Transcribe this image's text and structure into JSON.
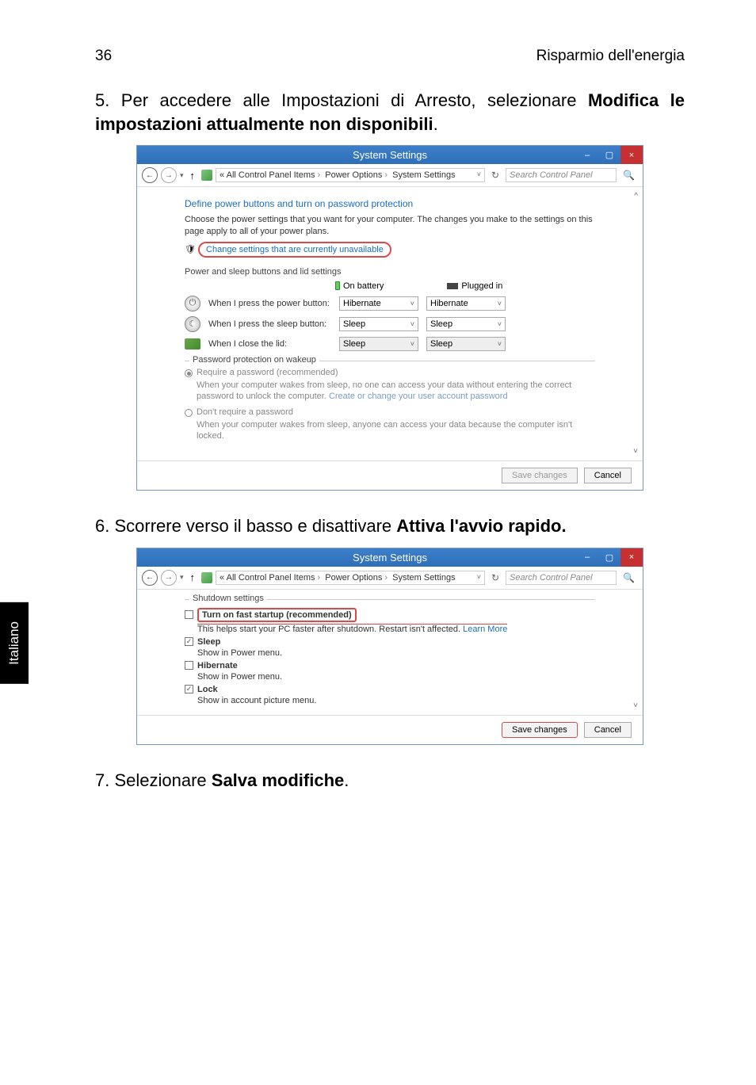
{
  "header": {
    "page_num": "36",
    "doc_title": "Risparmio dell'energia"
  },
  "sidebar_label": "Italiano",
  "step5": {
    "prefix": "5. Per accedere alle Impostazioni di Arresto, selezionare ",
    "bold": "Modifica le impostazioni attualmente non disponibili",
    "suffix": "."
  },
  "step6": {
    "prefix": "6. Scorrere verso il basso e disattivare ",
    "bold": "Attiva l'avvio rapido.",
    "suffix": ""
  },
  "step7": {
    "prefix": "7. Selezionare ",
    "bold": "Salva modifiche",
    "suffix": "."
  },
  "win": {
    "title": "System Settings",
    "min": "–",
    "max": "▢",
    "close": "×",
    "back": "←",
    "fwd": "→",
    "up": "↑",
    "refresh": "↻",
    "search_placeholder": "Search Control Panel",
    "mag": "🔍",
    "breadcrumb": {
      "pre": "«",
      "p1": "All Control Panel Items",
      "p2": "Power Options",
      "p3": "System Settings",
      "sep": "›"
    }
  },
  "shot1": {
    "heading": "Define power buttons and turn on password protection",
    "intro": "Choose the power settings that you want for your computer. The changes you make to the settings on this page apply to all of your power plans.",
    "change_link": "Change settings that are currently unavailable",
    "shield": "🛡",
    "section1": "Power and sleep buttons and lid settings",
    "col_battery": "On battery",
    "col_plugged": "Plugged in",
    "rows": {
      "power": {
        "label": "When I press the power button:",
        "op_b": "Hibernate",
        "op_p": "Hibernate"
      },
      "sleep": {
        "label": "When I press the sleep button:",
        "op_b": "Sleep",
        "op_p": "Sleep"
      },
      "lid": {
        "label": "When I close the lid:",
        "op_b": "Sleep",
        "op_p": "Sleep"
      }
    },
    "protection": {
      "legend": "Password protection on wakeup",
      "opt1": "Require a password (recommended)",
      "opt1_desc_a": "When your computer wakes from sleep, no one can access your data without entering the correct password to unlock the computer. ",
      "opt1_link": "Create or change your user account password",
      "opt2": "Don't require a password",
      "opt2_desc": "When your computer wakes from sleep, anyone can access your data because the computer isn't locked."
    },
    "save": "Save changes",
    "cancel": "Cancel"
  },
  "shot2": {
    "shutdown_legend": "Shutdown settings",
    "fast": {
      "label": "Turn on fast startup (recommended)",
      "desc_a": "This helps start your PC faster after shutdown. Restart isn't affected. ",
      "link": "Learn More"
    },
    "sleep": {
      "label": "Sleep",
      "desc": "Show in Power menu."
    },
    "hibernate": {
      "label": "Hibernate",
      "desc": "Show in Power menu."
    },
    "lock": {
      "label": "Lock",
      "desc": "Show in account picture menu."
    },
    "save": "Save changes",
    "cancel": "Cancel"
  }
}
